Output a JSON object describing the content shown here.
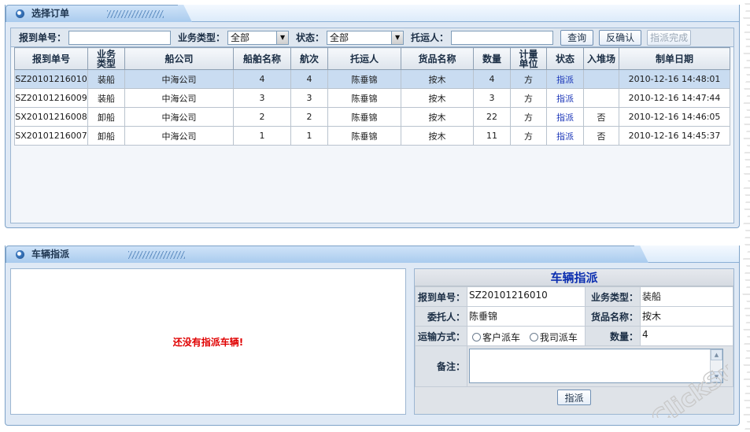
{
  "top_panel": {
    "title": "选择订单",
    "search": {
      "report_no_label": "报到单号：",
      "report_no_value": "",
      "biz_type_label": "业务类型：",
      "biz_type_value": "全部",
      "status_label": "状态：",
      "status_value": "全部",
      "shipper_label": "托运人：",
      "shipper_value": "",
      "query_button": "查询",
      "reverse_confirm_button": "反确认",
      "dispatch_done_button": "指派完成"
    },
    "columns": [
      "报到单号",
      "业务类型",
      "船公司",
      "船舶名称",
      "航次",
      "托运人",
      "货品名称",
      "数量",
      "计量单位",
      "状态",
      "入堆场",
      "制单日期"
    ],
    "rows": [
      [
        "SZ20101216010",
        "装船",
        "中海公司",
        "4",
        "4",
        "陈垂锦",
        "按木",
        "4",
        "方",
        "指派",
        "",
        "2010-12-16 14:48:01"
      ],
      [
        "SZ20101216009",
        "装船",
        "中海公司",
        "3",
        "3",
        "陈垂锦",
        "按木",
        "3",
        "方",
        "指派",
        "",
        "2010-12-16 14:47:44"
      ],
      [
        "SX20101216008",
        "卸船",
        "中海公司",
        "2",
        "2",
        "陈垂锦",
        "按木",
        "22",
        "方",
        "指派",
        "否",
        "2010-12-16 14:46:05"
      ],
      [
        "SX20101216007",
        "卸船",
        "中海公司",
        "1",
        "1",
        "陈垂锦",
        "按木",
        "11",
        "方",
        "指派",
        "否",
        "2010-12-16 14:45:37"
      ]
    ]
  },
  "bottom_panel": {
    "title": "车辆指派",
    "empty_message": "还没有指派车辆!",
    "form": {
      "title": "车辆指派",
      "report_no_label": "报到单号：",
      "report_no_value": "SZ20101216010",
      "biz_type_label": "业务类型：",
      "biz_type_value": "装船",
      "consignor_label": "委托人：",
      "consignor_value": "陈垂锦",
      "goods_label": "货品名称：",
      "goods_value": "按木",
      "transport_label": "运输方式：",
      "transport_option_1": "客户派车",
      "transport_option_2": "我司派车",
      "quantity_label": "数量：",
      "quantity_value": "4",
      "remark_label": "备注：",
      "remark_value": "",
      "dispatch_button": "指派"
    }
  },
  "watermark": "ClickSun"
}
